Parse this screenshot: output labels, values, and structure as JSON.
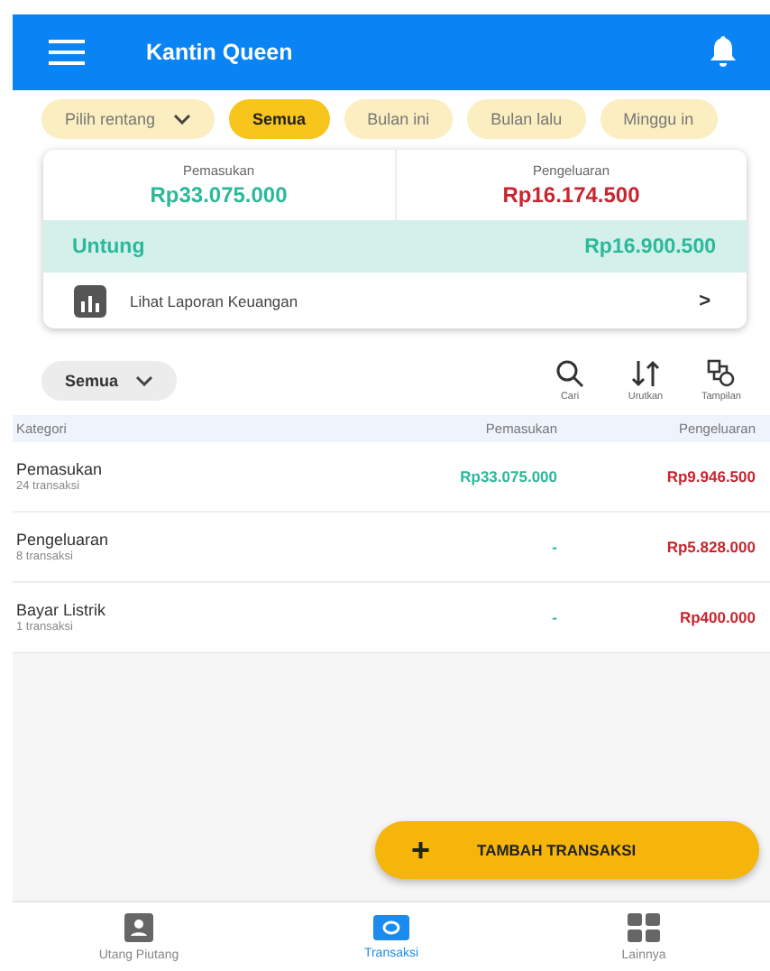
{
  "app_bar": {
    "title": "Kantin Queen"
  },
  "filters": [
    {
      "label": "Pilih rentang",
      "kind": "dropdown",
      "selected": false
    },
    {
      "label": "Semua",
      "kind": "chip",
      "selected": true
    },
    {
      "label": "Bulan ini",
      "kind": "chip",
      "selected": false
    },
    {
      "label": "Bulan lalu",
      "kind": "chip",
      "selected": false
    },
    {
      "label": "Minggu in",
      "kind": "chip",
      "selected": false
    }
  ],
  "summary": {
    "income_label": "Pemasukan",
    "income": "Rp33.075.000",
    "expense_label": "Pengeluaran",
    "expense": "Rp16.174.500",
    "profit_label": "Untung",
    "profit": "Rp16.900.500",
    "report_link": "Lihat Laporan Keuangan",
    "report_arrow": ">"
  },
  "toolbar": {
    "dropdown": "Semua",
    "actions": [
      {
        "label": "Cari",
        "kind": "search"
      },
      {
        "label": "Urutkan",
        "kind": "sort"
      },
      {
        "label": "Tampilan",
        "kind": "view"
      }
    ]
  },
  "table": {
    "columns": [
      "Kategori",
      "Pemasukan",
      "Pengeluaran"
    ],
    "rows": [
      {
        "name": "Pemasukan",
        "count": "24 transaksi",
        "income": "Rp33.075.000",
        "expense": "Rp9.946.500"
      },
      {
        "name": "Pengeluaran",
        "count": "8 transaksi",
        "income": "-",
        "expense": "Rp5.828.000"
      },
      {
        "name": "Bayar Listrik",
        "count": "1 transaksi",
        "income": "-",
        "expense": "Rp400.000"
      }
    ]
  },
  "fab": {
    "icon": "+",
    "label": "TAMBAH TRANSAKSI"
  },
  "bottom_nav": [
    {
      "label": "Utang Piutang",
      "kind": "contact",
      "selected": false
    },
    {
      "label": "Transaksi",
      "kind": "money",
      "selected": true
    },
    {
      "label": "Lainnya",
      "kind": "grid",
      "selected": false
    }
  ]
}
